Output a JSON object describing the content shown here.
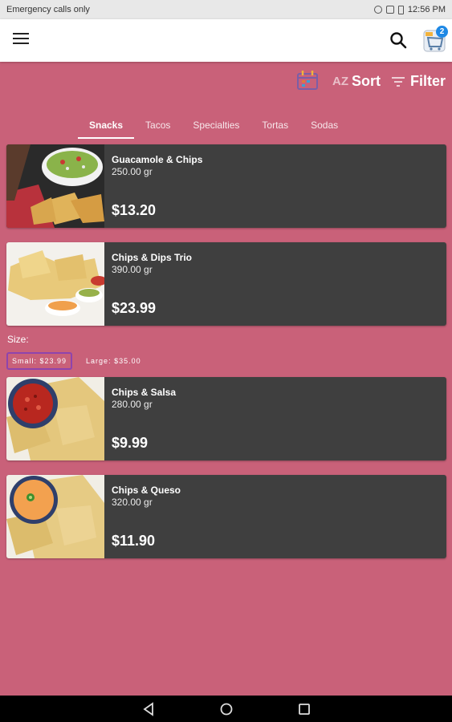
{
  "status_bar": {
    "carrier": "Emergency calls only",
    "time": "12:56 PM"
  },
  "cart": {
    "count": "2"
  },
  "toolbar": {
    "sort_label": "Sort",
    "sort_az": "AZ",
    "filter_label": "Filter"
  },
  "tabs": [
    {
      "label": "Snacks",
      "active": true
    },
    {
      "label": "Tacos"
    },
    {
      "label": "Specialties"
    },
    {
      "label": "Tortas"
    },
    {
      "label": "Sodas"
    }
  ],
  "products": [
    {
      "name": "Guacamole & Chips",
      "weight": "250.00 gr",
      "price": "$13.20"
    },
    {
      "name": "Chips & Dips Trio",
      "weight": "390.00 gr",
      "price": "$23.99"
    },
    {
      "name": "Chips & Salsa",
      "weight": "280.00 gr",
      "price": "$9.99"
    },
    {
      "name": "Chips & Queso",
      "weight": "320.00 gr",
      "price": "$11.90"
    }
  ],
  "size": {
    "label": "Size:",
    "options": [
      {
        "label": "Small: $23.99",
        "selected": true
      },
      {
        "label": "Large: $35.00"
      }
    ]
  },
  "colors": {
    "background": "#c96179",
    "card": "#3f3f3f",
    "selected_border": "#8e44ad",
    "badge": "#1e88e5"
  }
}
